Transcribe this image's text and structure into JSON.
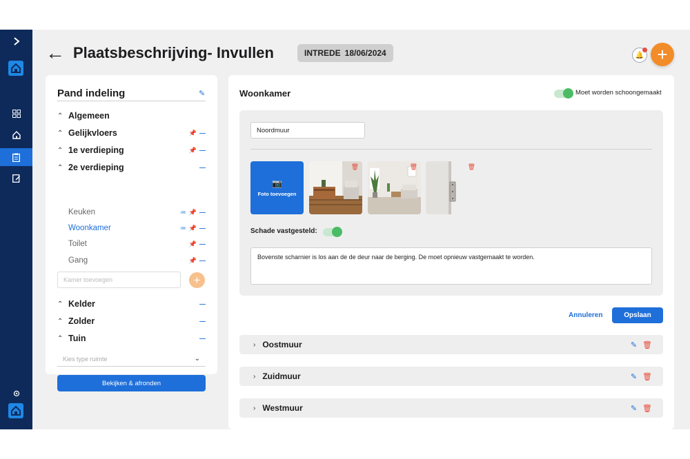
{
  "page": {
    "title": "Plaatsbeschrijving- Invullen",
    "badge_label": "INTREDE",
    "badge_date": "18/06/2024"
  },
  "colors": {
    "navy": "#0e2a5a",
    "primary": "#1e6fd9",
    "accent_orange": "#f28c28",
    "toggle_green": "#4cbb66"
  },
  "sidebar": {
    "items": [
      {
        "icon": "chevron-right-icon"
      },
      {
        "icon": "logo-icon"
      },
      {
        "icon": "grid-icon"
      },
      {
        "icon": "home-icon"
      },
      {
        "icon": "clipboard-icon"
      },
      {
        "icon": "edit-document-icon"
      },
      {
        "icon": "settings-icon"
      },
      {
        "icon": "logo-icon"
      }
    ]
  },
  "left_panel": {
    "title": "Pand indeling",
    "sections": [
      {
        "label": "Algemeen"
      },
      {
        "label": "Gelijkvloers"
      },
      {
        "label": "1e verdieping"
      },
      {
        "label": "2e verdieping"
      }
    ],
    "rooms": [
      {
        "label": "Keuken"
      },
      {
        "label": "Woonkamer"
      },
      {
        "label": "Toilet"
      },
      {
        "label": "Gang"
      }
    ],
    "new_room_placeholder": "Kamer toevoegen",
    "lower_sections": [
      {
        "label": "Kelder"
      },
      {
        "label": "Zolder"
      },
      {
        "label": "Tuin"
      }
    ],
    "type_placeholder": "Kies type ruimte",
    "finish_button": "Bekijken & afronden"
  },
  "main": {
    "room_title": "Woonkamer",
    "clean_toggle_label": "Moet worden schoongemaakt",
    "clean_toggle_on": true,
    "wall_name": "Noordmuur",
    "add_photo_label": "Foto toevoegen",
    "damage_label": "Schade vastgesteld:",
    "damage_toggle_on": true,
    "damage_text": "Bovenste scharnier is los aan de de deur naar de berging. De moet opnieuw vastgemaakt te worden.",
    "cancel_label": "Annuleren",
    "save_label": "Opslaan",
    "walls": [
      {
        "name": "Oostmuur"
      },
      {
        "name": "Zuidmuur"
      },
      {
        "name": "Westmuur"
      }
    ]
  }
}
